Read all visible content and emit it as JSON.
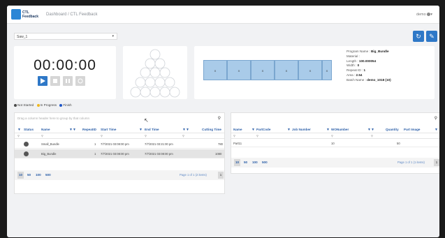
{
  "header": {
    "logo_line1": "CTL",
    "logo_line2": "Feedback",
    "breadcrumb": "Dashboard / CTL Feedback",
    "user": "demo"
  },
  "toolbar": {
    "machine_select": "Saw_1",
    "refresh_icon": "refresh-icon",
    "edit_icon": "edit-icon"
  },
  "timer": {
    "display": "00:00:00"
  },
  "sequence_boxes": [
    "X",
    "X",
    "X",
    "X",
    "X",
    "X"
  ],
  "program_info": {
    "program_label": "Program Name :",
    "program_value": "Big_Bundle",
    "material_label": "Material :",
    "material_value": "",
    "length_label": "Length :",
    "length_value": "100.000054",
    "width_label": "Width :",
    "width_value": "0",
    "repeat_label": "Repeat ID :",
    "repeat_value": "1",
    "area_label": "Area :",
    "area_value": "2.54",
    "batch_label": "Batch Name :",
    "batch_value": "demo_1018 (10)"
  },
  "legend": [
    {
      "label": "Not Started",
      "color": "#4a4a4a"
    },
    {
      "label": "In Progress",
      "color": "#f0b81e"
    },
    {
      "label": "Finish",
      "color": "#1e56c8"
    }
  ],
  "left_grid": {
    "group_hint": "Drag a column header here to group by that column",
    "columns": [
      "Status",
      "Name",
      "RepeatID",
      "Start Time",
      "End Time",
      "Cutting Time"
    ],
    "rows": [
      {
        "name": "Small_Bundle",
        "repeat": "1",
        "start": "7/7/2021 03:08:00 pm",
        "end": "7/7/2021 03:21:00 pm",
        "cutting": "780"
      },
      {
        "name": "Big_Bundle",
        "repeat": "1",
        "start": "7/7/2021 03:08:00 pm",
        "end": "7/7/2021 03:08:00 pm",
        "cutting": "1080"
      }
    ],
    "page_sizes": [
      "10",
      "50",
      "100",
      "500"
    ],
    "page_info": "Page 1 of 1 (2 items)",
    "page_number": "1"
  },
  "right_grid": {
    "columns": [
      "Name",
      "PartCode",
      "Job Number",
      "WONumber",
      "Quantity",
      "Part Image"
    ],
    "rows": [
      {
        "name": "Part11",
        "part_code": "",
        "job": "",
        "wo": "10",
        "qty": "50"
      }
    ],
    "page_sizes": [
      "10",
      "50",
      "100",
      "500"
    ],
    "page_info": "Page 1 of 1 (1 items)",
    "page_number": "1"
  }
}
